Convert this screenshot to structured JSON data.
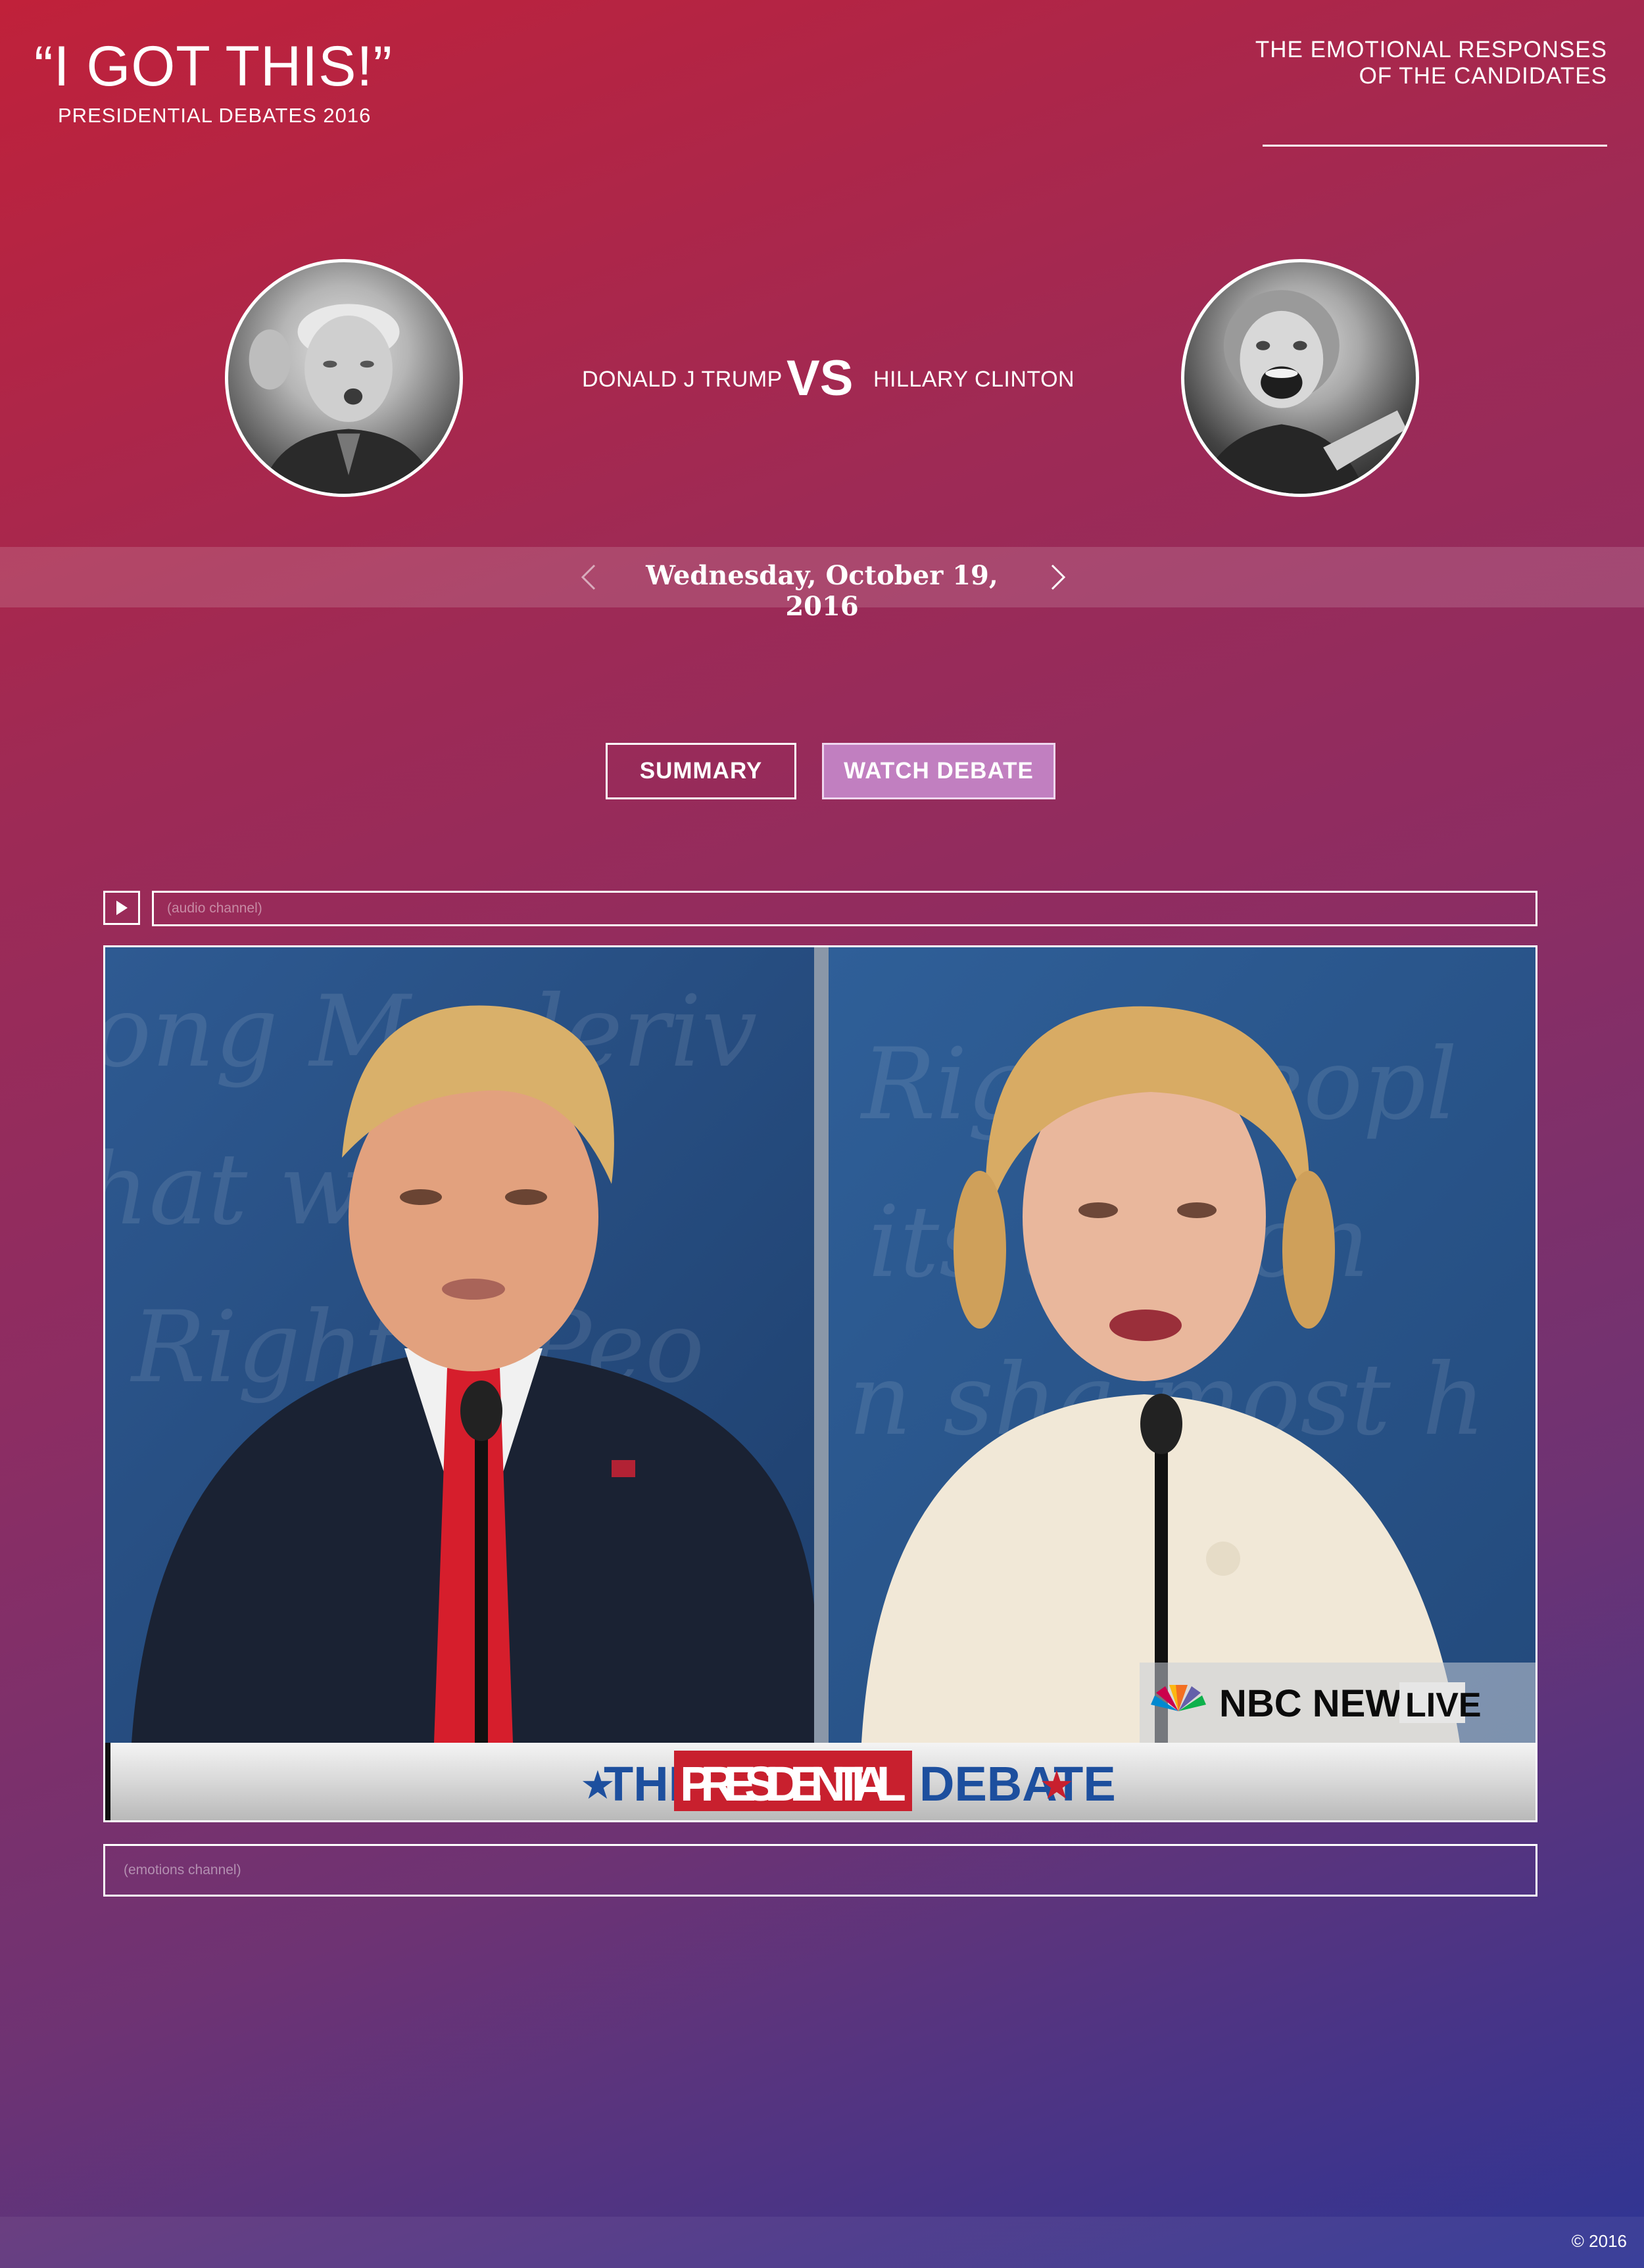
{
  "header": {
    "title": "“I GOT THIS!”",
    "subtitle": "PRESIDENTIAL DEBATES 2016",
    "tagline_line1": "THE EMOTIONAL RESPONSES",
    "tagline_line2": "OF THE CANDIDATES"
  },
  "candidates": {
    "left_name": "DONALD J TRUMP",
    "vs": "VS",
    "right_name": "HILLARY CLINTON"
  },
  "date_nav": {
    "date": "Wednesday, October 19, 2016",
    "prev_icon": "chevron-left-icon",
    "next_icon": "chevron-right-icon"
  },
  "tabs": {
    "summary": "SUMMARY",
    "watch": "WATCH DEBATE",
    "active": "watch"
  },
  "player": {
    "play_icon": "play-icon",
    "audio_placeholder": "(audio channel)",
    "emotions_placeholder": "(emotions channel)",
    "banner_the": "THE",
    "banner_presidential": "PRESIDENTIAL",
    "banner_debate": "DEBATE",
    "network": "NBC NEWS",
    "live": "LIVE"
  },
  "footer": {
    "copyright": "© 2016"
  },
  "colors": {
    "gradient_top": "#c0213a",
    "gradient_bottom": "#2e3594",
    "watch_tab": "#c17fc0",
    "banner_red": "#c8202e",
    "banner_blue": "#1d4f9e"
  }
}
